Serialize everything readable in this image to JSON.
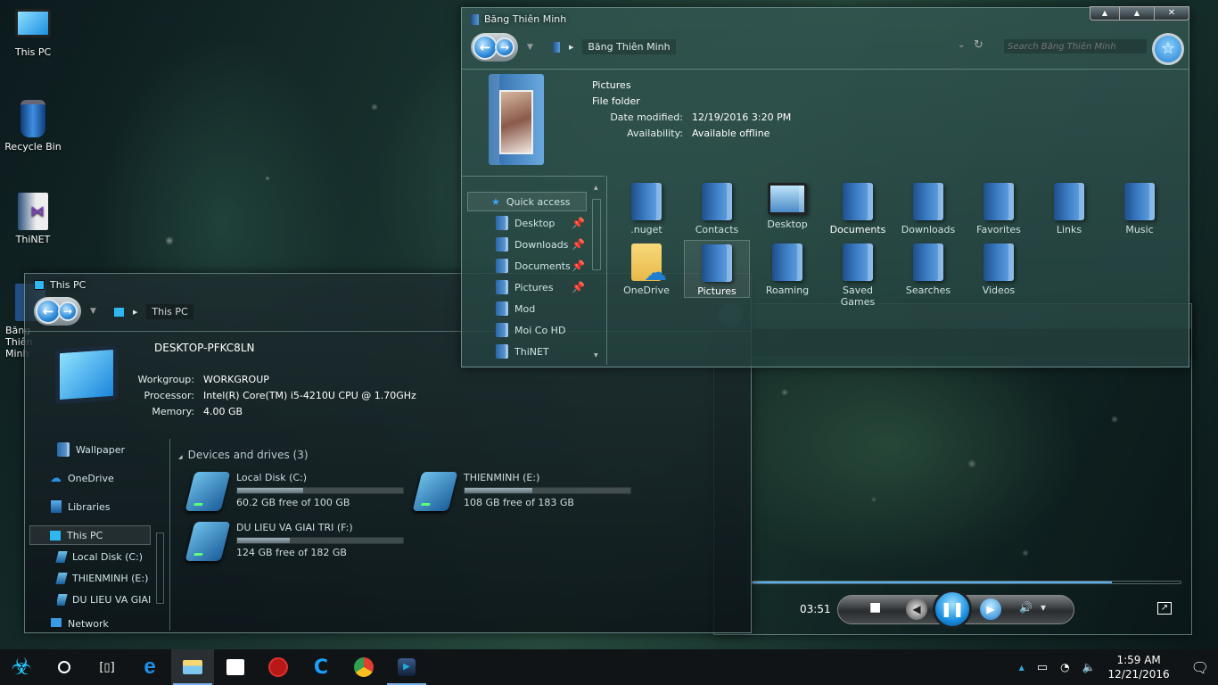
{
  "desktop": {
    "icons": [
      {
        "label": "This PC"
      },
      {
        "label": "Recycle Bin"
      },
      {
        "label": "ThiNET"
      },
      {
        "label": "Băng Thiên Minh"
      }
    ]
  },
  "explorer_user": {
    "title": "Băng Thiên Minh",
    "breadcrumb": "Băng Thiên Minh",
    "search_placeholder": "Search Băng Thiên Minh",
    "window_buttons": [
      "▲",
      "▲",
      "✕"
    ],
    "details": {
      "name": "Pictures",
      "type": "File folder",
      "date_label": "Date modified:",
      "date_value": "12/19/2016 3:20 PM",
      "avail_label": "Availability:",
      "avail_value": "Available offline"
    },
    "nav": [
      {
        "label": "Quick access",
        "pinned": false
      },
      {
        "label": "Desktop",
        "pinned": true
      },
      {
        "label": "Downloads",
        "pinned": true
      },
      {
        "label": "Documents",
        "pinned": true
      },
      {
        "label": "Pictures",
        "pinned": true
      },
      {
        "label": "Mod",
        "pinned": false
      },
      {
        "label": "Moi Co HD",
        "pinned": false
      },
      {
        "label": "ThiNET",
        "pinned": false
      }
    ],
    "items": [
      {
        "label": ".nuget"
      },
      {
        "label": "Contacts"
      },
      {
        "label": "Desktop"
      },
      {
        "label": "Documents"
      },
      {
        "label": "Downloads"
      },
      {
        "label": "Favorites"
      },
      {
        "label": "Links"
      },
      {
        "label": "Music"
      },
      {
        "label": "OneDrive"
      },
      {
        "label": "Pictures"
      },
      {
        "label": "Roaming"
      },
      {
        "label": "Saved Games"
      },
      {
        "label": "Searches"
      },
      {
        "label": "Videos"
      }
    ]
  },
  "explorer_pc": {
    "title": "This PC",
    "breadcrumb": "This PC",
    "computer_name": "DESKTOP-PFKC8LN",
    "specs": [
      {
        "k": "Workgroup:",
        "v": "WORKGROUP"
      },
      {
        "k": "Processor:",
        "v": "Intel(R) Core(TM) i5-4210U CPU @ 1.70GHz"
      },
      {
        "k": "Memory:",
        "v": "4.00 GB"
      }
    ],
    "nav": [
      {
        "label": "Wallpaper"
      },
      {
        "label": "OneDrive"
      },
      {
        "label": "Libraries"
      },
      {
        "label": "This PC"
      },
      {
        "label": "Local Disk (C:)"
      },
      {
        "label": "THIENMINH (E:)"
      },
      {
        "label": "DU LIEU VA GIAI TRI (F:)"
      },
      {
        "label": "Network"
      }
    ],
    "section": "Devices and drives (3)",
    "drives": [
      {
        "name": "Local Disk (C:)",
        "info": "60.2 GB free of 100 GB",
        "used_fraction": 0.398
      },
      {
        "name": "THIENMINH (E:)",
        "info": "108 GB free of 183 GB",
        "used_fraction": 0.41
      },
      {
        "name": "DU LIEU VA GIAI TRI (F:)",
        "info": "124 GB free of 182 GB",
        "used_fraction": 0.319
      }
    ]
  },
  "media_player": {
    "time": "03:51",
    "progress_fraction": 0.84,
    "controls": {
      "stop": "■",
      "prev": "◀",
      "pause": "❚❚",
      "next": "▶",
      "volume": "🔊",
      "menu": "▾",
      "switch": "↗"
    }
  },
  "taskbar": {
    "time": "1:59 AM",
    "date": "12/21/2016"
  }
}
